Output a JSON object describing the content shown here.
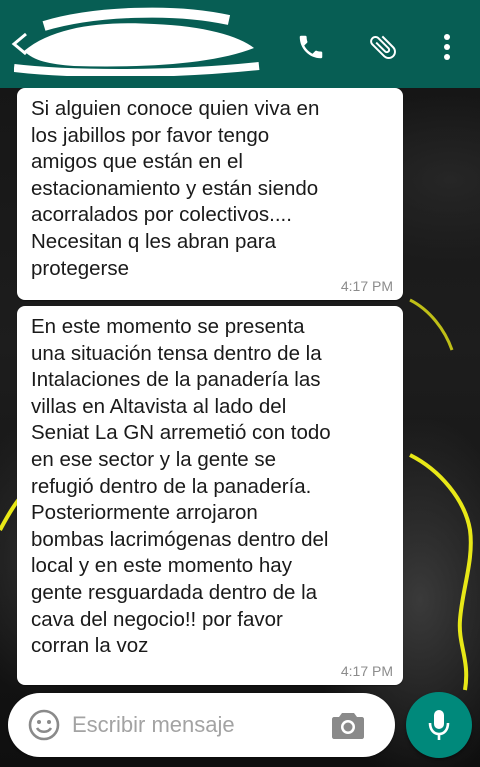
{
  "header": {
    "contact_name": "",
    "icons": [
      "back-arrow-icon",
      "phone-icon",
      "paperclip-icon",
      "more-vert-icon"
    ]
  },
  "messages": [
    {
      "text": "Si alguien conoce quien viva en\nlos jabillos por favor tengo\namigos que están en el\nestacionamiento y están siendo\nacorralados por colectivos....\nNecesitan q les abran para\nprotegerse",
      "time": "4:17 PM"
    },
    {
      "text": "En este momento se presenta\nuna situación tensa dentro de la\nIntalaciones de la panadería las\nvillas en Altavista al lado del\nSeniat La GN arremetió con todo\nen ese sector y la gente se\nrefugió dentro de la panadería.\nPosteriormente arrojaron\nbombas lacrimógenas dentro del\nlocal y en este momento hay\ngente resguardada dentro de la\ncava del negocio!! por favor\ncorran la voz",
      "time": "4:17 PM"
    }
  ],
  "composer": {
    "placeholder": "Escribir mensaje",
    "value": "",
    "icons": [
      "emoji-icon",
      "camera-icon",
      "mic-icon"
    ]
  },
  "colors": {
    "header": "#075e54",
    "mic_button": "#00897b",
    "bubble": "#ffffff",
    "time_text": "#8c8c8c",
    "wallpaper_annotation": "#e8e817"
  }
}
